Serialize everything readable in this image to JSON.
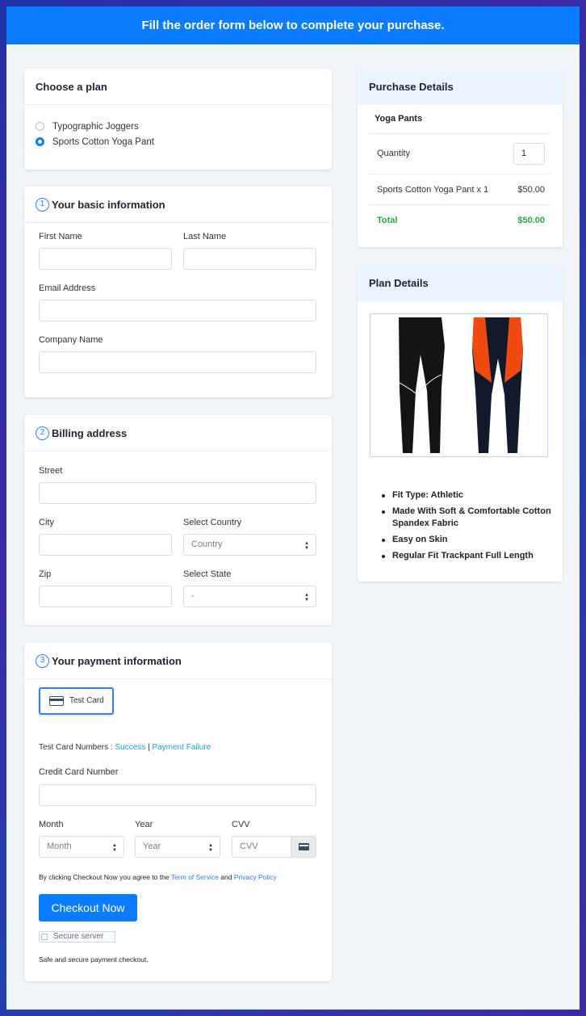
{
  "banner": {
    "text": "Fill the order form below to complete your purchase."
  },
  "plan": {
    "title": "Choose a plan",
    "options": [
      {
        "label": "Typographic Joggers",
        "selected": false
      },
      {
        "label": "Sports Cotton Yoga Pant",
        "selected": true
      }
    ]
  },
  "basic": {
    "step": "1",
    "title": "Your basic information",
    "first_name_label": "First Name",
    "last_name_label": "Last Name",
    "email_label": "Email Address",
    "company_label": "Company Name",
    "first_name_value": "",
    "last_name_value": "",
    "email_value": "",
    "company_value": ""
  },
  "billing": {
    "step": "2",
    "title": "Billing address",
    "street_label": "Street",
    "city_label": "City",
    "country_label": "Select Country",
    "country_value": "Country",
    "zip_label": "Zip",
    "state_label": "Select State",
    "state_value": "-"
  },
  "payment": {
    "step": "3",
    "title": "Your payment information",
    "card_button": "Test Card",
    "test_numbers_label": "Test Card Numbers :",
    "success_link": "Success",
    "separator": "|",
    "failure_link": "Payment Failure",
    "cc_label": "Credit Card Number",
    "month_label": "Month",
    "month_value": "Month",
    "year_label": "Year",
    "year_value": "Year",
    "cvv_label": "CVV",
    "cvv_placeholder": "CVV",
    "agree_prefix": "By clicking Checkout Now you agree to the",
    "tos_link": "Term of Service",
    "and_text": "and",
    "privacy_link": "Privacy Policy",
    "checkout_button": "Checkout Now",
    "secure_badge": "Secure server",
    "safe_text": "Safe and secure payment checkout."
  },
  "purchase": {
    "title": "Purchase Details",
    "product": "Yoga Pants",
    "quantity_label": "Quantity",
    "quantity_value": "1",
    "line_item": "Sports Cotton Yoga Pant x 1",
    "line_price": "$50.00",
    "total_label": "Total",
    "total_value": "$50.00"
  },
  "plan_details": {
    "title": "Plan Details",
    "features": [
      "Fit Type: Athletic",
      "Made With Soft & Comfortable Cotton Spandex Fabric",
      "Easy on Skin",
      "Regular Fit Trackpant Full Length"
    ]
  },
  "colors": {
    "accent": "#0a7cff",
    "total": "#28a745",
    "link": "#1aa3c4"
  }
}
